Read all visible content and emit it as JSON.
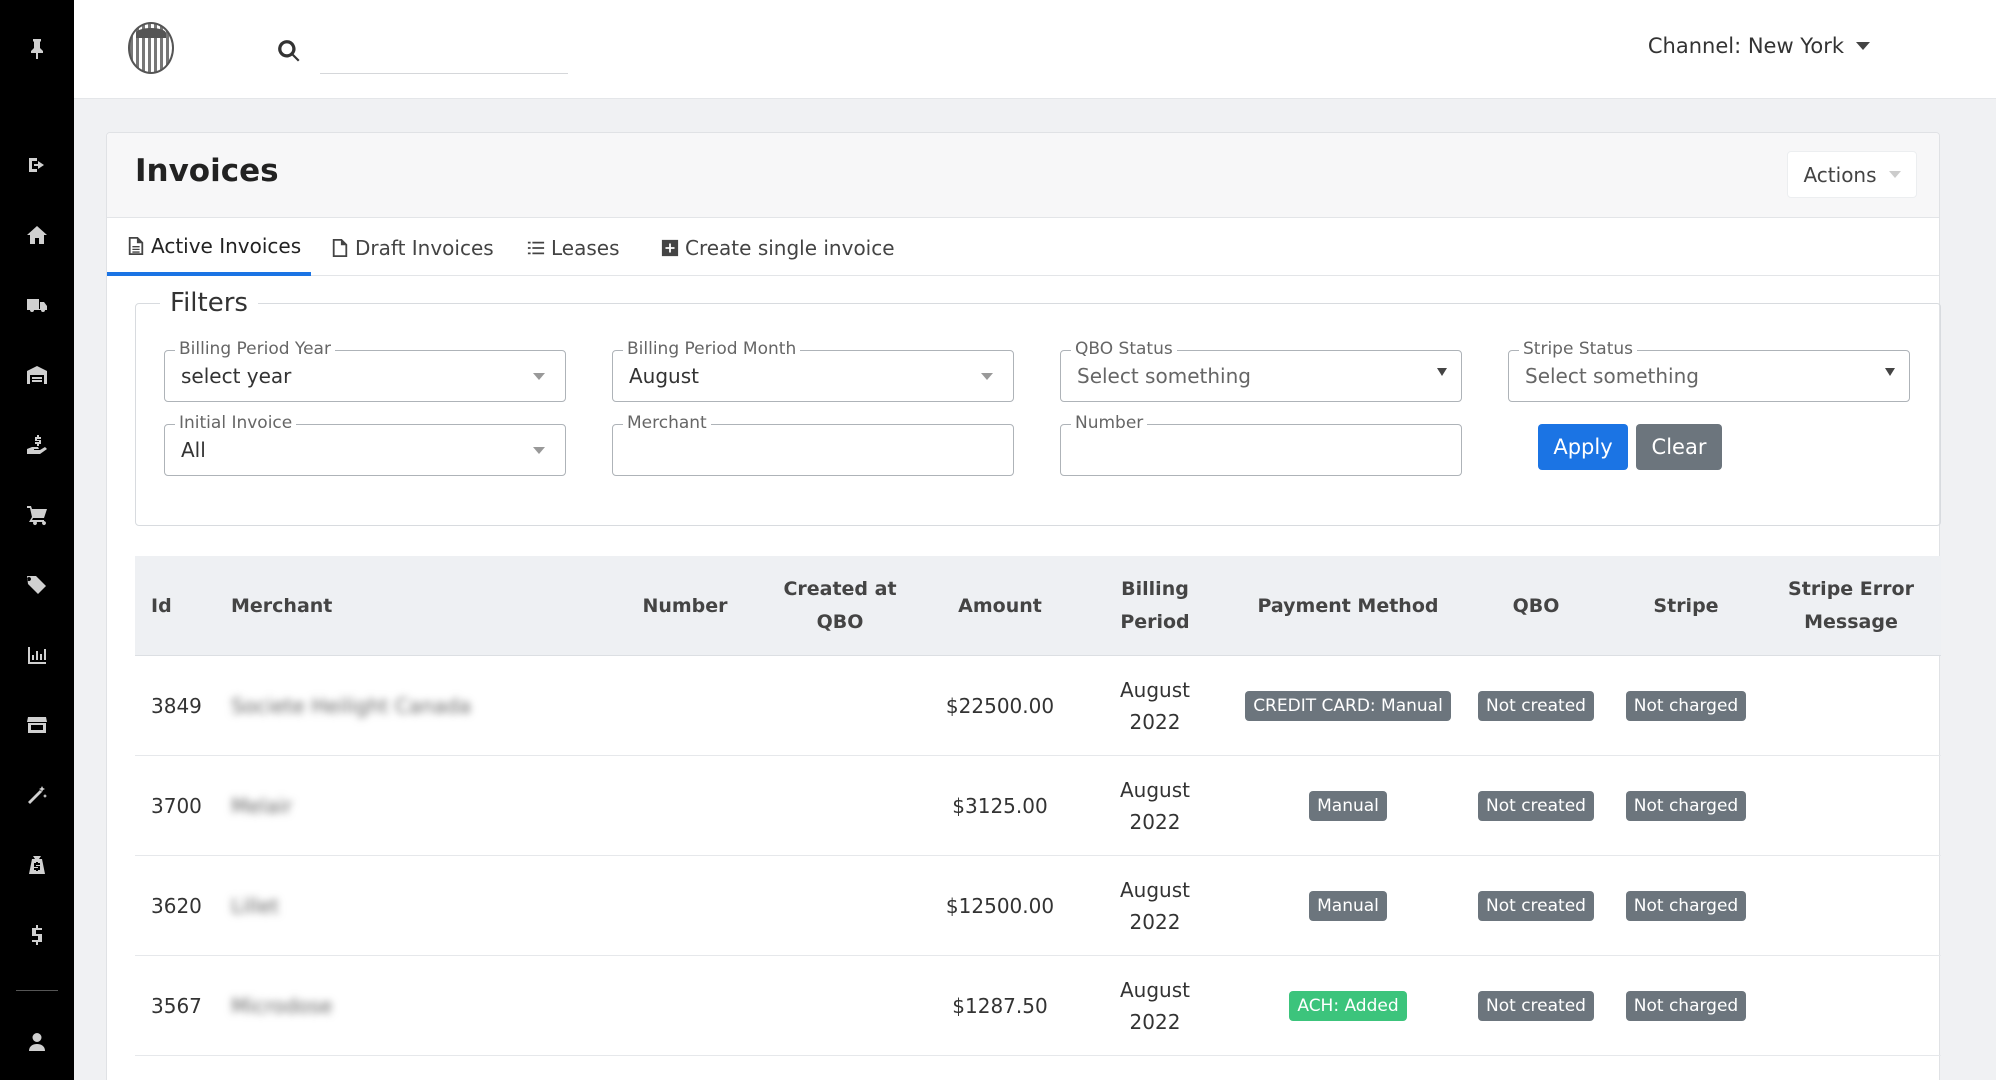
{
  "header": {
    "search_placeholder": "",
    "channel_label": "Channel: New York"
  },
  "sidebar": {
    "icons": [
      "pin-icon",
      "logout-icon",
      "home-icon",
      "truck-icon",
      "warehouse-icon",
      "hand-dollar-icon",
      "cart-icon",
      "tags-icon",
      "bar-chart-icon",
      "store-icon",
      "magic-wand-icon",
      "bag-dollar-icon",
      "dollar-icon",
      "user-icon"
    ]
  },
  "card": {
    "title": "Invoices",
    "actions_label": "Actions"
  },
  "tabs": [
    {
      "label": "Active Invoices"
    },
    {
      "label": "Draft Invoices"
    },
    {
      "label": "Leases"
    },
    {
      "label": "Create single invoice"
    }
  ],
  "filters": {
    "legend": "Filters",
    "billing_year": {
      "label": "Billing Period Year",
      "value": "select year"
    },
    "billing_month": {
      "label": "Billing Period Month",
      "value": "August"
    },
    "qbo_status": {
      "label": "QBO Status",
      "value": "Select something"
    },
    "stripe_status": {
      "label": "Stripe Status",
      "value": "Select something"
    },
    "initial_invoice": {
      "label": "Initial Invoice",
      "value": "All"
    },
    "merchant": {
      "label": "Merchant",
      "value": ""
    },
    "number": {
      "label": "Number",
      "value": ""
    },
    "apply_label": "Apply",
    "clear_label": "Clear"
  },
  "table": {
    "columns": {
      "id": "Id",
      "merchant": "Merchant",
      "number": "Number",
      "created_at_qbo_1": "Created at",
      "created_at_qbo_2": "QBO",
      "amount": "Amount",
      "billing_period_1": "Billing",
      "billing_period_2": "Period",
      "payment_method": "Payment Method",
      "qbo": "QBO",
      "stripe": "Stripe",
      "stripe_error_1": "Stripe Error",
      "stripe_error_2": "Message"
    },
    "rows": [
      {
        "id": "3849",
        "merchant": "Societe Heilight Canada",
        "number": "",
        "created_at_qbo": "",
        "amount": "$22500.00",
        "billing_month": "August",
        "billing_year": "2022",
        "payment_method": "CREDIT CARD: Manual",
        "qbo": "Not created",
        "stripe": "Not charged",
        "stripe_error": ""
      },
      {
        "id": "3700",
        "merchant": "Melair",
        "number": "",
        "created_at_qbo": "",
        "amount": "$3125.00",
        "billing_month": "August",
        "billing_year": "2022",
        "payment_method": "Manual",
        "qbo": "Not created",
        "stripe": "Not charged",
        "stripe_error": ""
      },
      {
        "id": "3620",
        "merchant": "Lillet",
        "number": "",
        "created_at_qbo": "",
        "amount": "$12500.00",
        "billing_month": "August",
        "billing_year": "2022",
        "payment_method": "Manual",
        "qbo": "Not created",
        "stripe": "Not charged",
        "stripe_error": ""
      },
      {
        "id": "3567",
        "merchant": "Microdose",
        "number": "",
        "created_at_qbo": "",
        "amount": "$1287.50",
        "billing_month": "August",
        "billing_year": "2022",
        "payment_method": "ACH: Added",
        "qbo": "Not created",
        "stripe": "Not charged",
        "stripe_error": ""
      }
    ]
  },
  "colors": {
    "primary": "#1b74e4",
    "secondary": "#6c757d",
    "success": "#3cc47c",
    "sidebar": "#000000"
  }
}
